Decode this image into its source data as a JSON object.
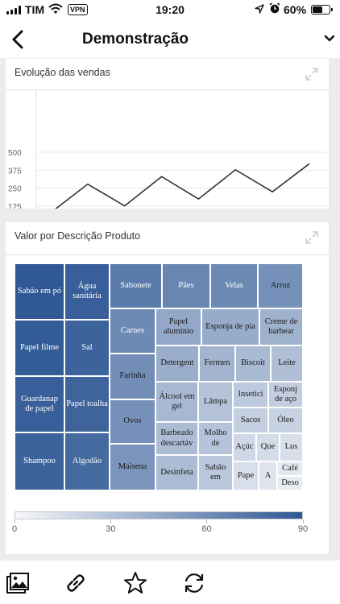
{
  "status_bar": {
    "carrier": "TIM",
    "vpn": "VPN",
    "time": "19:20",
    "battery": "60%",
    "battery_level": 0.6
  },
  "nav": {
    "title": "Demonstração"
  },
  "line_card": {
    "title": "Evolução das vendas",
    "chart_data": {
      "type": "line",
      "y_ticks": [
        "500",
        "375",
        "250",
        "125"
      ],
      "ylim": [
        0,
        500
      ],
      "series": [
        {
          "values": [
            80,
            278,
            127,
            330,
            175,
            378,
            225,
            420
          ]
        }
      ],
      "grid": true
    }
  },
  "treemap_card": {
    "title": "Valor por Descrição Produto",
    "chart_data": {
      "type": "treemap",
      "color_scale": {
        "min": 0,
        "max": 90,
        "ticks": [
          "0",
          "30",
          "60",
          "90"
        ],
        "low_color": "#f7f8fb",
        "high_color": "#2f5894"
      },
      "tiles": [
        {
          "label": "Sabão em pó",
          "value": 90
        },
        {
          "label": "Água sanitária",
          "value": 86
        },
        {
          "label": "Papel filme",
          "value": 88
        },
        {
          "label": "Sal",
          "value": 84
        },
        {
          "label": "Guardanap de papel",
          "value": 86
        },
        {
          "label": "Papel toalha",
          "value": 83
        },
        {
          "label": "Shampoo",
          "value": 84
        },
        {
          "label": "Algodão",
          "value": 80
        },
        {
          "label": "Sabonete",
          "value": 70
        },
        {
          "label": "Pães",
          "value": 64
        },
        {
          "label": "Velas",
          "value": 62
        },
        {
          "label": "Arroz",
          "value": 58
        },
        {
          "label": "Carnes",
          "value": 62
        },
        {
          "label": "Farinha",
          "value": 60
        },
        {
          "label": "Ovos",
          "value": 58
        },
        {
          "label": "Maisena",
          "value": 56
        },
        {
          "label": "Papel alumínio",
          "value": 45
        },
        {
          "label": "Esponja de pia",
          "value": 43
        },
        {
          "label": "Creme de barbear",
          "value": 40
        },
        {
          "label": "Detergent",
          "value": 42
        },
        {
          "label": "Fermen",
          "value": 38
        },
        {
          "label": "Biscoit",
          "value": 35
        },
        {
          "label": "Leite",
          "value": 32
        },
        {
          "label": "Álcool em gel",
          "value": 36
        },
        {
          "label": "Lâmpa",
          "value": 30
        },
        {
          "label": "Insetici",
          "value": 26
        },
        {
          "label": "Esponj de aço",
          "value": 24
        },
        {
          "label": "Sacos",
          "value": 23
        },
        {
          "label": "Óleo",
          "value": 22
        },
        {
          "label": "Barbeado descartáv",
          "value": 34
        },
        {
          "label": "Molho de",
          "value": 30
        },
        {
          "label": "Açúc",
          "value": 18
        },
        {
          "label": "Que",
          "value": 16
        },
        {
          "label": "Lus",
          "value": 14
        },
        {
          "label": "Desinfeta",
          "value": 34
        },
        {
          "label": "Sabão em",
          "value": 28
        },
        {
          "label": "Pape",
          "value": 14
        },
        {
          "label": "A",
          "value": 11
        },
        {
          "label": "Café",
          "value": 9
        },
        {
          "label": "Deso",
          "value": 7
        }
      ]
    }
  },
  "icons": {
    "back": "chevron-left-icon",
    "menu": "chevron-down-icon",
    "expand": "expand-icon",
    "bottom": [
      "gallery-icon",
      "link-icon",
      "star-icon",
      "refresh-icon"
    ]
  }
}
